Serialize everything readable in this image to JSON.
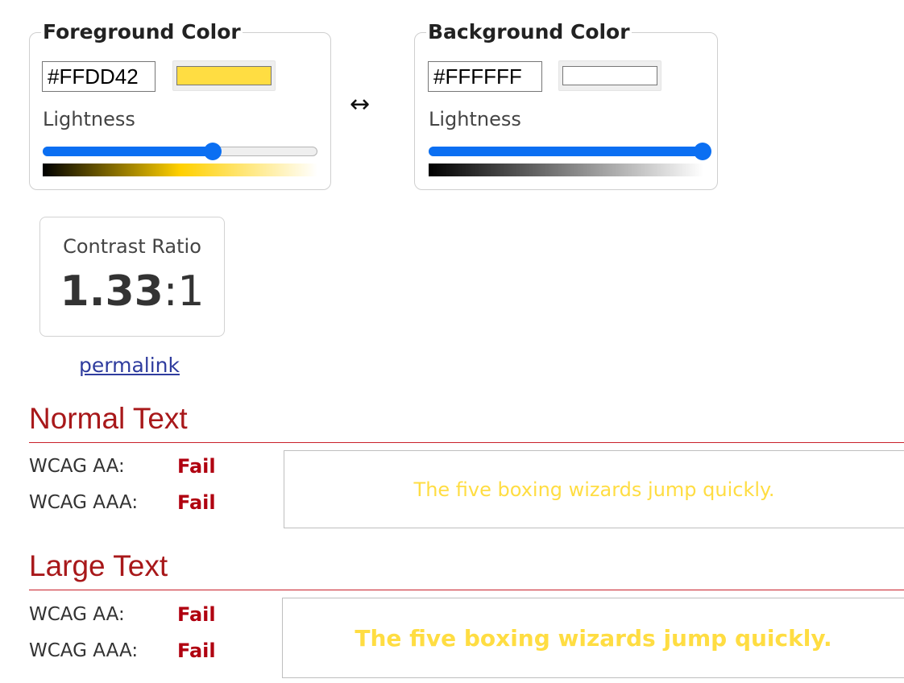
{
  "foreground": {
    "legend": "Foreground Color",
    "hex_value": "#FFDD42",
    "swatch_color": "#FFDD42",
    "lightness_label": "Lightness",
    "lightness_fraction": 0.62,
    "gradient_colors": [
      "#000000",
      "#FFD000",
      "#FFFFFF"
    ]
  },
  "swap_symbol": "↔",
  "background": {
    "legend": "Background Color",
    "hex_value": "#FFFFFF",
    "swatch_color": "#FFFFFF",
    "lightness_label": "Lightness",
    "lightness_fraction": 1.0,
    "gradient_colors": [
      "#000000",
      "#FFFFFF"
    ]
  },
  "contrast": {
    "label": "Contrast Ratio",
    "value_bold": "1.33",
    "value_rest": ":1"
  },
  "permalink": "permalink",
  "normal_text": {
    "title": "Normal Text",
    "rows": [
      {
        "label": "WCAG AA:",
        "result": "Fail"
      },
      {
        "label": "WCAG AAA:",
        "result": "Fail"
      }
    ],
    "sample": "The five boxing wizards jump quickly."
  },
  "large_text": {
    "title": "Large Text",
    "rows": [
      {
        "label": "WCAG AA:",
        "result": "Fail"
      },
      {
        "label": "WCAG AAA:",
        "result": "Fail"
      }
    ],
    "sample": "The five boxing wizards jump quickly."
  },
  "colors": {
    "accent_red": "#A8181A",
    "fail_red": "#B00010",
    "slider_blue": "#0B6FF2",
    "sample_text": "#FFDD42"
  }
}
